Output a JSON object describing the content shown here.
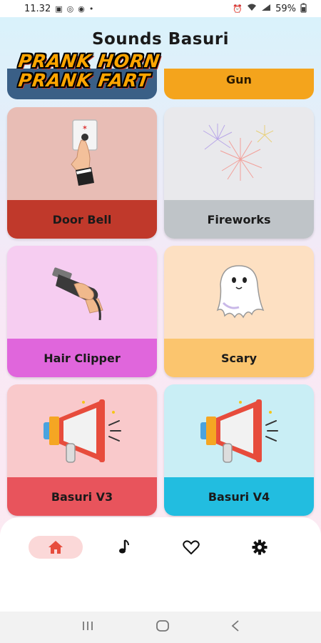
{
  "status_bar": {
    "time": "11.32",
    "battery": "59%"
  },
  "app": {
    "title": "Sounds Basuri"
  },
  "banner": {
    "line1": "PRANK HORN",
    "line2": "PRANK FART"
  },
  "top_cards": {
    "right_label": "Gun"
  },
  "cards": [
    {
      "label": "Door Bell",
      "icon": "doorbell-icon",
      "bg": "#e8bdb5",
      "label_bg": "#c0392b"
    },
    {
      "label": "Fireworks",
      "icon": "fireworks-icon",
      "bg": "#e9e9ec",
      "label_bg": "#bfc4c8"
    },
    {
      "label": "Hair Clipper",
      "icon": "hair-clipper-icon",
      "bg": "#f6cdf1",
      "label_bg": "#e066dc"
    },
    {
      "label": "Scary",
      "icon": "ghost-icon",
      "bg": "#fde0c2",
      "label_bg": "#fbc56e"
    },
    {
      "label": "Basuri V3",
      "icon": "megaphone-icon",
      "bg": "#f9c9cb",
      "label_bg": "#e8545c"
    },
    {
      "label": "Basuri V4",
      "icon": "megaphone-icon",
      "bg": "#c9eef5",
      "label_bg": "#22bde0"
    }
  ],
  "nav": {
    "items": [
      "home-icon",
      "music-icon",
      "heart-icon",
      "settings-icon"
    ]
  }
}
